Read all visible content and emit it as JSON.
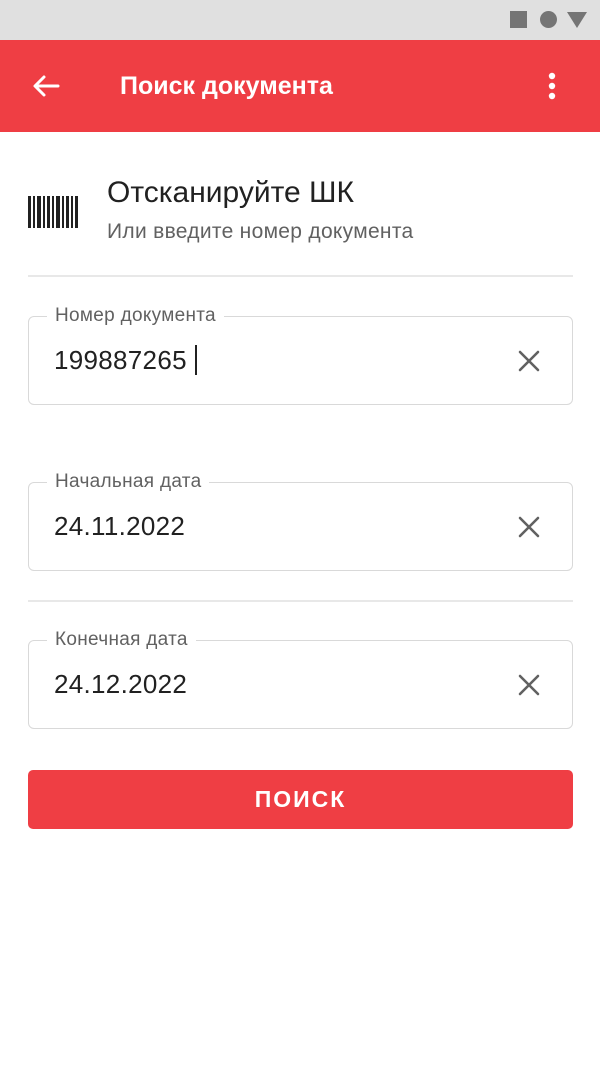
{
  "app_bar": {
    "title": "Поиск документа",
    "back_icon": "arrow-left-icon",
    "menu_icon": "more-vert-icon",
    "color": "#ef3e44"
  },
  "scan": {
    "icon": "barcode-icon",
    "title": "Отсканируйте ШК",
    "subtitle": "Или введите номер документа"
  },
  "fields": {
    "doc_number": {
      "label": "Номер документа",
      "value": "199887265"
    },
    "start_date": {
      "label": "Начальная дата",
      "value": "24.11.2022"
    },
    "end_date": {
      "label": "Конечная дата",
      "value": "24.12.2022"
    }
  },
  "search_button": {
    "label": "ПОИСК"
  }
}
